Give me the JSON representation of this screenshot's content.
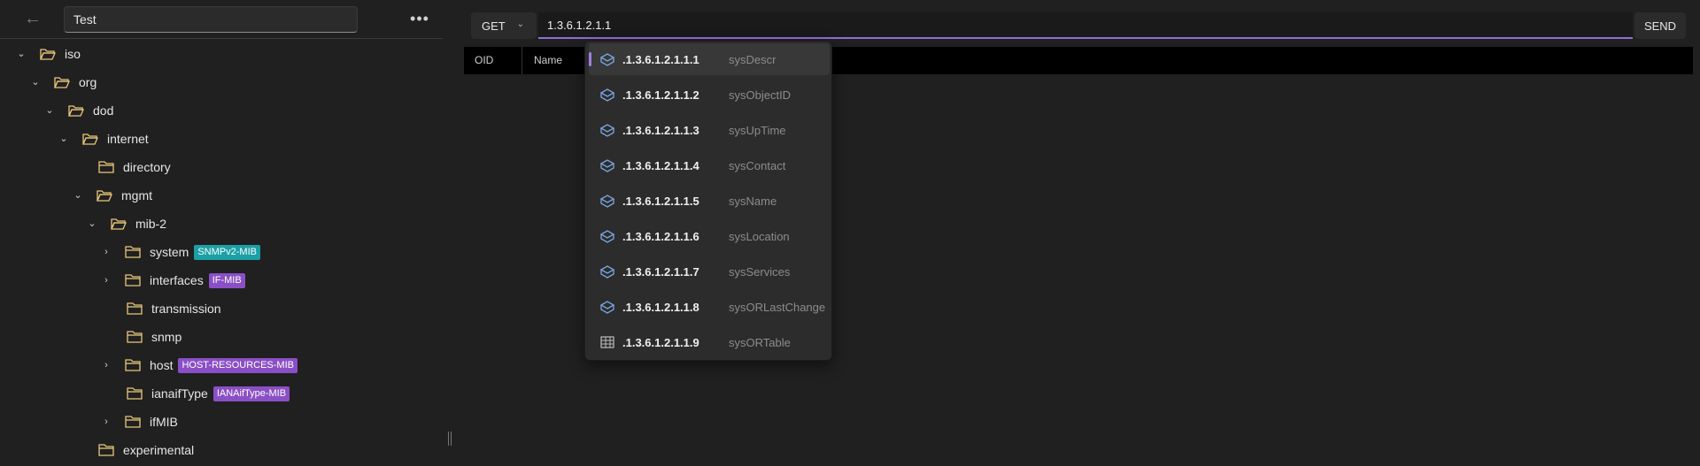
{
  "search": {
    "value": "Test"
  },
  "tree": {
    "nodes": [
      {
        "label": "iso",
        "expanded": true
      },
      {
        "label": "org",
        "expanded": true
      },
      {
        "label": "dod",
        "expanded": true
      },
      {
        "label": "internet",
        "expanded": true
      },
      {
        "label": "directory"
      },
      {
        "label": "mgmt",
        "expanded": true
      },
      {
        "label": "mib-2",
        "expanded": true
      },
      {
        "label": "system",
        "expanded": false,
        "badge": "SNMPv2-MIB"
      },
      {
        "label": "interfaces",
        "expanded": false,
        "badge": "IF-MIB"
      },
      {
        "label": "transmission"
      },
      {
        "label": "snmp"
      },
      {
        "label": "host",
        "expanded": false,
        "badge": "HOST-RESOURCES-MIB"
      },
      {
        "label": "ianaifType",
        "badge": "IANAifType-MIB"
      },
      {
        "label": "ifMIB",
        "expanded": false
      },
      {
        "label": "experimental"
      }
    ]
  },
  "request": {
    "method": "GET",
    "oid_value": "1.3.6.1.2.1.1",
    "send_label": "SEND"
  },
  "table": {
    "columns": [
      "OID",
      "Name"
    ]
  },
  "autocomplete": {
    "items": [
      {
        "oid": ".1.3.6.1.2.1.1.1",
        "name": "sysDescr",
        "icon": "scalar-icon"
      },
      {
        "oid": ".1.3.6.1.2.1.1.2",
        "name": "sysObjectID",
        "icon": "scalar-icon"
      },
      {
        "oid": ".1.3.6.1.2.1.1.3",
        "name": "sysUpTime",
        "icon": "scalar-icon"
      },
      {
        "oid": ".1.3.6.1.2.1.1.4",
        "name": "sysContact",
        "icon": "scalar-icon"
      },
      {
        "oid": ".1.3.6.1.2.1.1.5",
        "name": "sysName",
        "icon": "scalar-icon"
      },
      {
        "oid": ".1.3.6.1.2.1.1.6",
        "name": "sysLocation",
        "icon": "scalar-icon"
      },
      {
        "oid": ".1.3.6.1.2.1.1.7",
        "name": "sysServices",
        "icon": "scalar-icon"
      },
      {
        "oid": ".1.3.6.1.2.1.1.8",
        "name": "sysORLastChange",
        "icon": "scalar-icon"
      },
      {
        "oid": ".1.3.6.1.2.1.1.9",
        "name": "sysORTable",
        "icon": "table-icon"
      }
    ]
  },
  "colors": {
    "accent": "#8f6fd6",
    "folder": "#e8c77a",
    "badge_teal": "#1ba0a5",
    "badge_purple": "#8a4fc6"
  }
}
